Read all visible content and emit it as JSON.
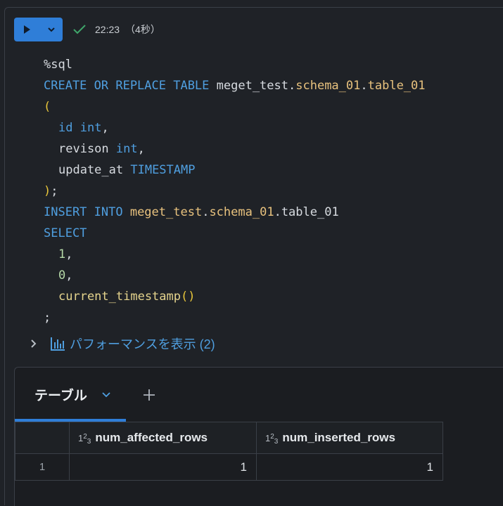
{
  "toolbar": {
    "status_time": "22:23",
    "status_duration": "（4秒）",
    "colors": {
      "run_button": "#2f7ed8",
      "success_check": "#3fa66a"
    }
  },
  "code": {
    "lines": [
      [
        {
          "t": "%sql",
          "c": "plain"
        }
      ],
      [
        {
          "t": "CREATE OR REPLACE TABLE ",
          "c": "kw"
        },
        {
          "t": "meget_test",
          "c": "plain"
        },
        {
          "t": ".",
          "c": "plain"
        },
        {
          "t": "schema_01",
          "c": "obj"
        },
        {
          "t": ".",
          "c": "plain"
        },
        {
          "t": "table_01",
          "c": "obj"
        }
      ],
      [
        {
          "t": "(",
          "c": "paren"
        }
      ],
      [
        {
          "t": "INDENT"
        },
        {
          "t": "id ",
          "c": "kw"
        },
        {
          "t": "int",
          "c": "kw"
        },
        {
          "t": ",",
          "c": "plain"
        }
      ],
      [
        {
          "t": "INDENT"
        },
        {
          "t": "revison ",
          "c": "plain"
        },
        {
          "t": "int",
          "c": "kw"
        },
        {
          "t": ",",
          "c": "plain"
        }
      ],
      [
        {
          "t": "INDENT"
        },
        {
          "t": "update_at ",
          "c": "plain"
        },
        {
          "t": "TIMESTAMP",
          "c": "kw"
        }
      ],
      [
        {
          "t": ")",
          "c": "paren"
        },
        {
          "t": ";",
          "c": "plain"
        }
      ],
      [
        {
          "t": "INSERT INTO ",
          "c": "kw"
        },
        {
          "t": "meget_test",
          "c": "obj"
        },
        {
          "t": ".",
          "c": "plain"
        },
        {
          "t": "schema_01",
          "c": "obj"
        },
        {
          "t": ".",
          "c": "plain"
        },
        {
          "t": "table_01",
          "c": "plain"
        }
      ],
      [
        {
          "t": "SELECT",
          "c": "kw"
        }
      ],
      [
        {
          "t": "INDENT"
        },
        {
          "t": "1",
          "c": "num"
        },
        {
          "t": ",",
          "c": "plain"
        }
      ],
      [
        {
          "t": "INDENT"
        },
        {
          "t": "0",
          "c": "num"
        },
        {
          "t": ",",
          "c": "plain"
        }
      ],
      [
        {
          "t": "INDENT"
        },
        {
          "t": "current_timestamp",
          "c": "fn"
        },
        {
          "t": "()",
          "c": "paren"
        }
      ],
      [
        {
          "t": ";",
          "c": "plain"
        }
      ]
    ]
  },
  "performance": {
    "label": "パフォーマンスを表示 (2)"
  },
  "results": {
    "tab_label": "テーブル",
    "columns": [
      {
        "type_icon": "123",
        "name": "num_affected_rows"
      },
      {
        "type_icon": "123",
        "name": "num_inserted_rows"
      }
    ],
    "rows": [
      {
        "index": "1",
        "values": [
          "1",
          "1"
        ]
      }
    ]
  }
}
